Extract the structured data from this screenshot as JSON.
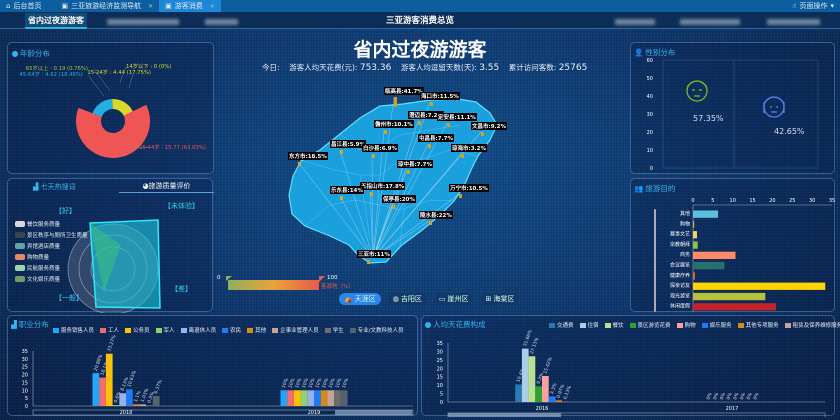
{
  "tabs": [
    {
      "label": "后台首页",
      "icon": "home-icon"
    },
    {
      "label": "三亚旅游经济监测导航",
      "icon": "monitor-icon"
    },
    {
      "label": "游客消费",
      "icon": "monitor-icon",
      "active": true
    }
  ],
  "page_ops": "页面操作",
  "nav": {
    "active_tab": "省内过夜游游客",
    "title": "三亚游客消费总览"
  },
  "main": {
    "title": "省内过夜游游客",
    "today_label": "今日:",
    "avg_spend_label": "游客人均天花费(元):",
    "avg_spend": "753.36",
    "avg_stay_label": "游客人均逗留天数(天):",
    "avg_stay": "3.55",
    "visits_label": "累计访问客数:",
    "visits": "25765"
  },
  "age": {
    "title": "年龄分布"
  },
  "radar": {
    "tab1": "七天热搜词",
    "tab2": "旅游质量评价",
    "indicators": [
      "【好】",
      "【未体验】",
      "【差】",
      "【一般】"
    ],
    "legend": [
      {
        "name": "餐饮服务质量",
        "color": "#d9d9d9"
      },
      {
        "name": "景区秩序与厕所卫生质量",
        "color": "#37474f"
      },
      {
        "name": "宾馆酒店质量",
        "color": "#5fa5a5"
      },
      {
        "name": "购物质量",
        "color": "#e9876a"
      },
      {
        "name": "民航服务质量",
        "color": "#9ed5b0"
      },
      {
        "name": "文化娱乐质量",
        "color": "#6f9e66"
      }
    ]
  },
  "map": {
    "legend_min": "0",
    "legend_max": "100",
    "legend_label": "客源地（%）",
    "labels": [
      "临高县:41.7%",
      "海口市:11.5%",
      "澄迈县:7.2%",
      "定安县:11.1%",
      "儋州市:10.1%",
      "文昌市:9.2%",
      "屯昌县:7.7%",
      "琼海市:3.2%",
      "昌江县:5.9%",
      "白沙县:6.9%",
      "东方市:18.5%",
      "琼中县:7.7%",
      "五指山市:17.8%",
      "乐东县:14%",
      "万宁市:10.5%",
      "保亭县:20%",
      "陵水县:22%",
      "三亚市:11%"
    ],
    "buttons": [
      {
        "label": "天涯区",
        "icon": "tent-icon",
        "active": true
      },
      {
        "label": "吉阳区",
        "icon": "globe-icon"
      },
      {
        "label": "崖州区",
        "icon": "monitor-icon"
      },
      {
        "label": "海棠区",
        "icon": "windows-icon"
      }
    ]
  },
  "gender": {
    "title": "性别分布",
    "male_pct": "57.35%",
    "female_pct": "42.65%"
  },
  "purpose": {
    "title": "旅游目的"
  },
  "occupation": {
    "title": "职业分布"
  },
  "spending": {
    "title": "人均天花费构成"
  },
  "chart_data": [
    {
      "id": "age",
      "type": "pie",
      "title": "年龄分布",
      "slices": [
        {
          "name": "14岁以下",
          "value": 0,
          "pct": "0%",
          "label": "14岁以下 : 0 (0%)",
          "color": "#1fb5e8"
        },
        {
          "name": "15-24岁",
          "value": 4.44,
          "label": "15-24岁 : 4.44 (17.75%)",
          "color": "#d8d82a"
        },
        {
          "name": "25-44岁",
          "value": 15.77,
          "label": "25-44岁 : 15.77 (63.03%)",
          "color": "#f05555"
        },
        {
          "name": "45-64岁",
          "value": 4.62,
          "label": "45-64岁 : 4.62 (18.46%)",
          "color": "#22b0e0"
        },
        {
          "name": "65岁以上",
          "value": 0.19,
          "label": "65岁以上 : 0.19 (0.76%)",
          "color": "#9cc93a"
        }
      ]
    },
    {
      "id": "gender",
      "type": "bar",
      "yticks": [
        "60",
        "50",
        "40",
        "30",
        "20",
        "10",
        "0"
      ],
      "ylim": [
        0,
        60
      ]
    },
    {
      "id": "purpose",
      "type": "bar",
      "orientation": "horizontal",
      "xlim": [
        0,
        35
      ],
      "xticks": [
        "0",
        "5",
        "10",
        "15",
        "20",
        "25",
        "30",
        "35"
      ],
      "categories": [
        "其他",
        "购物",
        "赛事文艺",
        "宗教朝拜",
        "商务",
        "会议展览",
        "健康疗养",
        "探亲访友",
        "观光游览",
        "休闲度假"
      ],
      "values": [
        6.3,
        0.3,
        1,
        1.2,
        10.7,
        7.9,
        0.5,
        33.3,
        18.2,
        20.9
      ],
      "colors": [
        "#5bc0de",
        "#e8a33c",
        "#f4d35e",
        "#8bc34a",
        "#ff8a65",
        "#26706e",
        "#d2691e",
        "#ffd400",
        "#b5c23a",
        "#c0232b"
      ]
    },
    {
      "id": "occupation",
      "type": "bar",
      "ylim": [
        0,
        35
      ],
      "yticks": [
        "35",
        "30",
        "25",
        "20",
        "15",
        "10",
        "5",
        "0"
      ],
      "categories": [
        "2018",
        "2019"
      ],
      "series": [
        {
          "name": "服务销售人员",
          "color": "#1ea7fd",
          "values": [
            20.88,
            10
          ]
        },
        {
          "name": "工人",
          "color": "#f46d6d",
          "values": [
            18.1,
            10
          ]
        },
        {
          "name": "公务员",
          "color": "#ffc107",
          "values": [
            33.27,
            10
          ]
        },
        {
          "name": "军人",
          "color": "#8fd16a",
          "values": [
            0.6,
            10
          ]
        },
        {
          "name": "离退休人员",
          "color": "#97b1ee",
          "values": [
            8.13,
            10
          ]
        },
        {
          "name": "农民",
          "color": "#1e7cf0",
          "values": [
            10.63,
            10
          ]
        },
        {
          "name": "其他",
          "color": "#d68a1e",
          "values": [
            1.1,
            10
          ]
        },
        {
          "name": "企事业管理人员",
          "color": "#c6a597",
          "values": [
            1.03,
            10
          ]
        },
        {
          "name": "学生",
          "color": "#6d6d6d",
          "values": [
            0.5,
            10
          ]
        },
        {
          "name": "专业/文教科技人员",
          "color": "#56626e",
          "values": [
            6.37,
            10
          ]
        }
      ],
      "labels": [
        [
          "20.88%",
          "18.1%",
          "33.27%",
          "0.6%",
          "8.13%",
          "10.63%",
          "1.1%",
          "1.03%",
          "0.5%",
          "6.37%"
        ],
        [
          "10%",
          "10%",
          "10%",
          "10%",
          "10%",
          "10%",
          "10%",
          "10%",
          "10%",
          "10%"
        ]
      ]
    },
    {
      "id": "spending",
      "type": "bar",
      "ylim": [
        0,
        35
      ],
      "yticks": [
        "35",
        "30",
        "25",
        "20",
        "15",
        "10",
        "5",
        "0"
      ],
      "categories": [
        "2016",
        "2017"
      ],
      "series": [
        {
          "name": "交通费",
          "color": "#2a7ab8",
          "values": [
            10.4,
            0
          ]
        },
        {
          "name": "住宿",
          "color": "#a8cfe6",
          "values": [
            31.66,
            0
          ]
        },
        {
          "name": "餐饮",
          "color": "#b8e08f",
          "values": [
            27.13,
            0
          ]
        },
        {
          "name": "景区游览花费",
          "color": "#2ea02e",
          "values": [
            9.3,
            0
          ]
        },
        {
          "name": "购物",
          "color": "#ffa0a0",
          "values": [
            15.42,
            0
          ]
        },
        {
          "name": "娱乐服务",
          "color": "#1e7cf0",
          "values": [
            3.3,
            0
          ]
        },
        {
          "name": "其他专项服务",
          "color": "#d68a1e",
          "values": [
            0.97,
            0
          ]
        },
        {
          "name": "租赁及保养维修服务",
          "color": "#c6a597",
          "values": [
            0.13,
            0
          ]
        }
      ],
      "labels": [
        [
          "10.4%",
          "31.66%",
          "27.13%",
          "9.3%",
          "15.42%",
          "3.3%",
          "0.97%",
          "0.13%"
        ],
        [
          "0%",
          "0%",
          "0%",
          "0%",
          "0%",
          "0%",
          "0%",
          "0%"
        ]
      ]
    }
  ]
}
